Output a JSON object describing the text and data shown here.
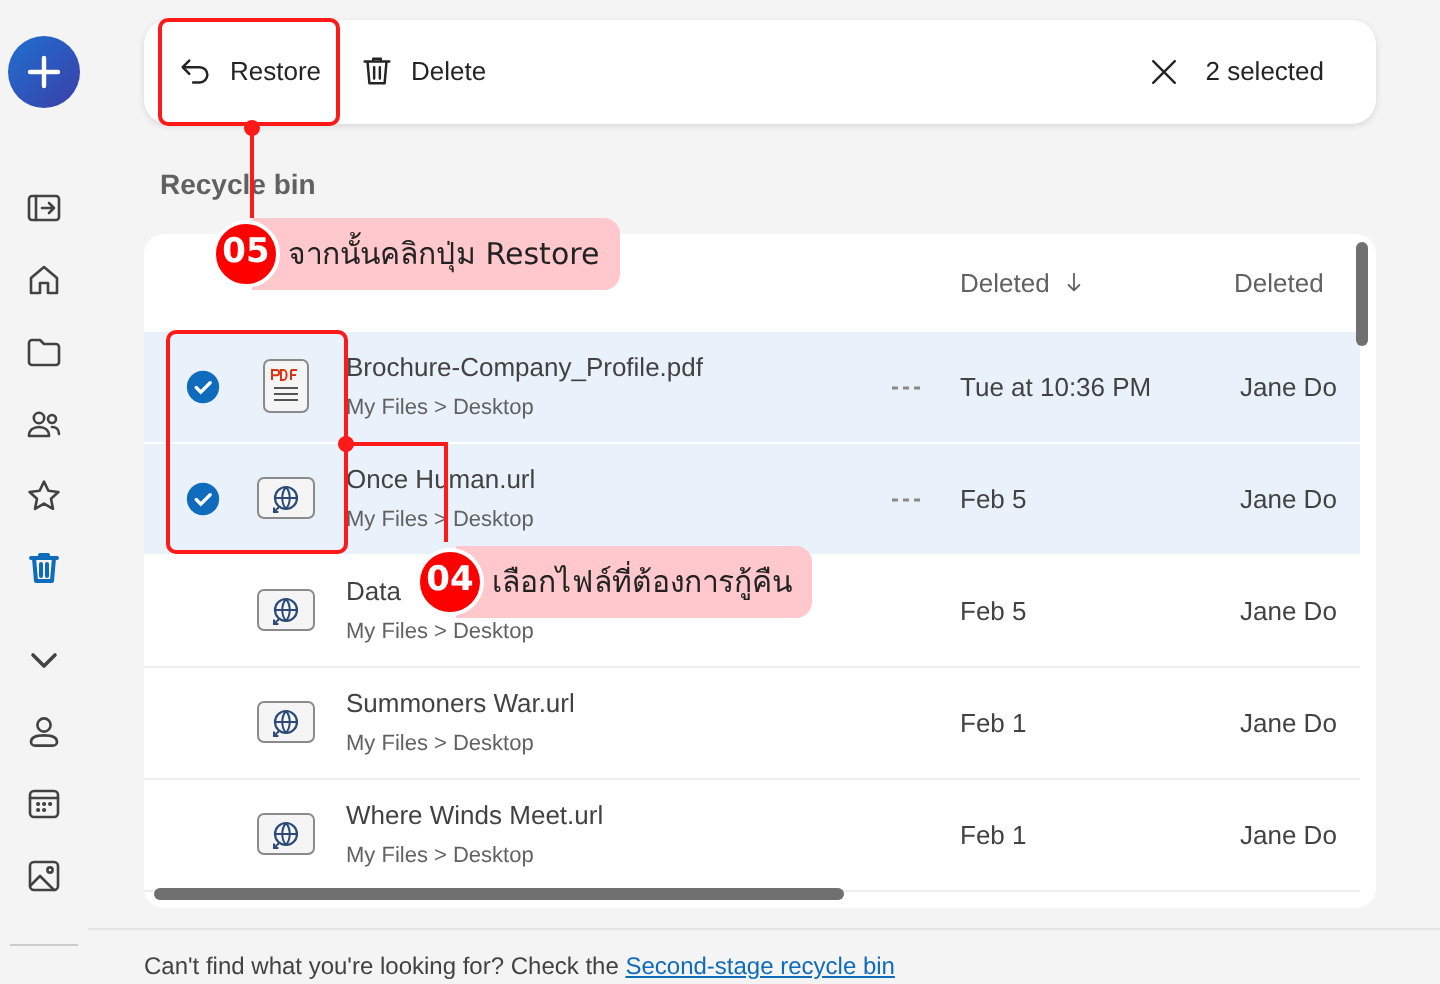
{
  "sidebar": {
    "items": [
      {
        "kind": "pane",
        "selected": false
      },
      {
        "kind": "home",
        "selected": false
      },
      {
        "kind": "folder",
        "selected": false
      },
      {
        "kind": "people",
        "selected": false
      },
      {
        "kind": "star",
        "selected": false
      },
      {
        "kind": "trash",
        "selected": true
      },
      {
        "kind": "chevron",
        "selected": false
      },
      {
        "kind": "person",
        "selected": false
      },
      {
        "kind": "calendar",
        "selected": false
      },
      {
        "kind": "image",
        "selected": false
      }
    ]
  },
  "toolbar": {
    "actions": [
      {
        "kind": "restore",
        "label": "Restore"
      },
      {
        "kind": "delete",
        "label": "Delete"
      }
    ],
    "selection": "2 selected"
  },
  "page_title": "Recycle bin",
  "table": {
    "columns": [
      {
        "label": "Deleted",
        "sorted": true
      },
      {
        "label": "Deleted",
        "sorted": false
      }
    ],
    "rows": [
      {
        "kind": "pdf",
        "selected": true,
        "name": "Brochure-Company_Profile.pdf",
        "location": "My Files > Desktop",
        "deleted": "Tue at 10:36 PM",
        "deleted_by": "Jane Do"
      },
      {
        "kind": "url",
        "selected": true,
        "name": "Once Human.url",
        "location": "My Files > Desktop",
        "deleted": "Feb 5",
        "deleted_by": "Jane Do"
      },
      {
        "kind": "url",
        "selected": false,
        "name": "Data",
        "location": "My Files > Desktop",
        "deleted": "Feb 5",
        "deleted_by": "Jane Do"
      },
      {
        "kind": "url",
        "selected": false,
        "name": "Summoners War.url",
        "location": "My Files > Desktop",
        "deleted": "Feb 1",
        "deleted_by": "Jane Do"
      },
      {
        "kind": "url",
        "selected": false,
        "name": "Where Winds Meet.url",
        "location": "My Files > Desktop",
        "deleted": "Feb 1",
        "deleted_by": "Jane Do"
      }
    ]
  },
  "footer": {
    "text": "Can't find what you're looking for? Check the",
    "link": "Second-stage recycle bin"
  },
  "annotations": [
    {
      "number": "05",
      "text": "จากนั้นคลิกปุ่ม Restore"
    },
    {
      "number": "04",
      "text": "เลือกไฟล์ที่ต้องการกู้คืน"
    }
  ]
}
